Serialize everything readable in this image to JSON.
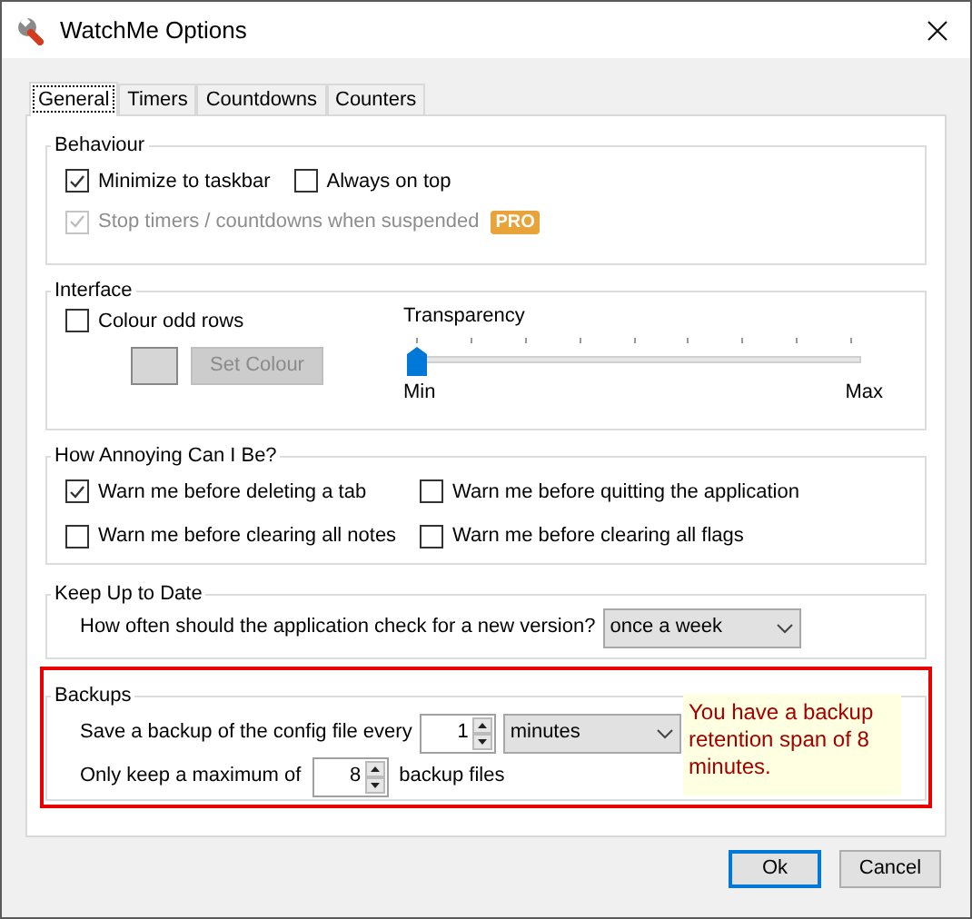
{
  "window": {
    "title": "WatchMe Options"
  },
  "tabs": [
    {
      "label": "General",
      "selected": true
    },
    {
      "label": "Timers",
      "selected": false
    },
    {
      "label": "Countdowns",
      "selected": false
    },
    {
      "label": "Counters",
      "selected": false
    }
  ],
  "behaviour": {
    "title": "Behaviour",
    "options": [
      {
        "label": "Minimize to taskbar",
        "checked": true,
        "disabled": false
      },
      {
        "label": "Always on top",
        "checked": false,
        "disabled": false
      },
      {
        "label": "Stop timers / countdowns when suspended",
        "checked": true,
        "disabled": true
      }
    ],
    "badge": "PRO"
  },
  "interface": {
    "title": "Interface",
    "colour_odd_rows": {
      "label": "Colour odd rows",
      "checked": false,
      "disabled": false
    },
    "set_colour_button": {
      "label": "Set Colour",
      "disabled": true
    },
    "transparency": {
      "label": "Transparency",
      "level": 0,
      "min_label": "Min",
      "max_label": "Max"
    }
  },
  "annoying": {
    "title": "How Annoying Can I Be?",
    "options": [
      {
        "label": "Warn me before deleting a tab",
        "checked": true,
        "disabled": false
      },
      {
        "label": "Warn me before quitting the application",
        "checked": false,
        "disabled": false
      },
      {
        "label": "Warn me before clearing all notes",
        "checked": false,
        "disabled": false
      },
      {
        "label": "Warn me before clearing all flags",
        "checked": false,
        "disabled": false
      }
    ]
  },
  "update": {
    "title": "Keep Up to Date",
    "question": "How often should the application check for a new version?",
    "frequency": "once a week"
  },
  "backups": {
    "title": "Backups",
    "highlighted": true,
    "every_label": "Save a backup of the config file every",
    "every_value": "1",
    "unit": "minutes",
    "max_label": "Only keep a maximum of",
    "max_value": "8",
    "max_suffix": "backup files",
    "note": "You have a backup retention span of 8 minutes."
  },
  "buttons": [
    {
      "label": "Ok",
      "default": true
    },
    {
      "label": "Cancel",
      "default": false
    }
  ]
}
